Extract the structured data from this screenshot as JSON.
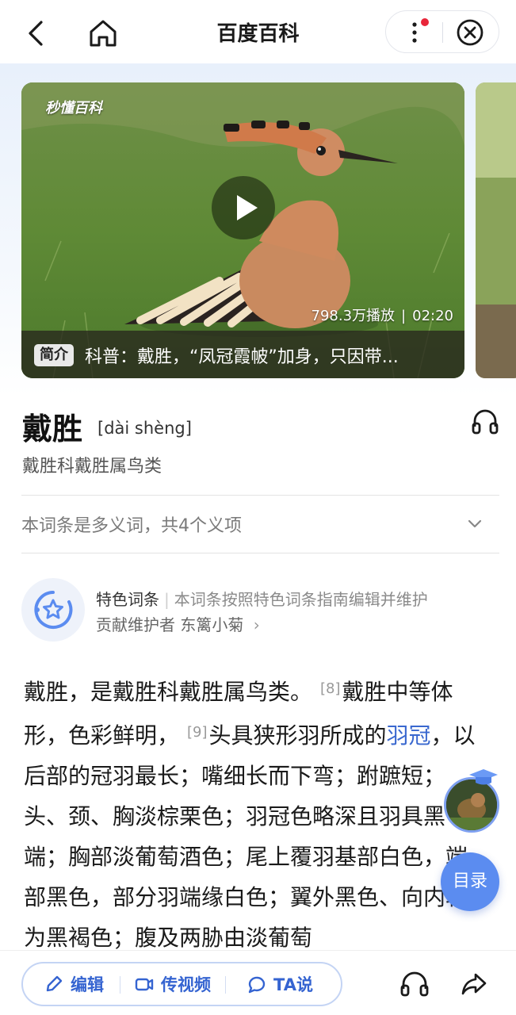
{
  "header": {
    "title": "百度百科"
  },
  "video": {
    "brand": "秒懂百科",
    "views": "798.3万播放",
    "duration": "02:20",
    "badge": "简介",
    "caption": "科普：戴胜，“凤冠霞帔”加身，只因带..."
  },
  "entry": {
    "title": "戴胜",
    "pinyin": "[dài shèng]",
    "subtitle": "戴胜科戴胜属鸟类",
    "polysemy": "本词条是多义词，共4个义项"
  },
  "feature": {
    "label": "特色词条",
    "description": "本词条按照特色词条指南编辑并维护",
    "contributor": "贡献维护者 东篱小菊",
    "contributor_arrow": "›"
  },
  "content": {
    "p1": "戴胜，是戴胜科戴胜属鸟类。",
    "ref1": "[8]",
    "p2": "戴胜中等体形，色彩鲜明，",
    "ref2": "[9]",
    "p3": "头具狭形羽所成的",
    "link": "羽冠",
    "p4": "，以后部的冠羽最长；嘴细长而下弯；跗蹠短；头、颈、胸淡棕栗色；羽冠色略深且羽具黑端；胸部淡葡萄酒色；尾上覆羽基部白色，端部黑色，部分羽端缘白色；翼外黑色、向内转为黑褐色；腹及两胁由淡葡萄"
  },
  "floating": {
    "toc": "目录"
  },
  "bottom": {
    "edit": "编辑",
    "video": "传视频",
    "ta": "TA说"
  },
  "colors": {
    "accent": "#3564d1",
    "link": "#3a68cf",
    "toc_bg": "#5b8cf0",
    "notify_dot": "#e8263a"
  }
}
